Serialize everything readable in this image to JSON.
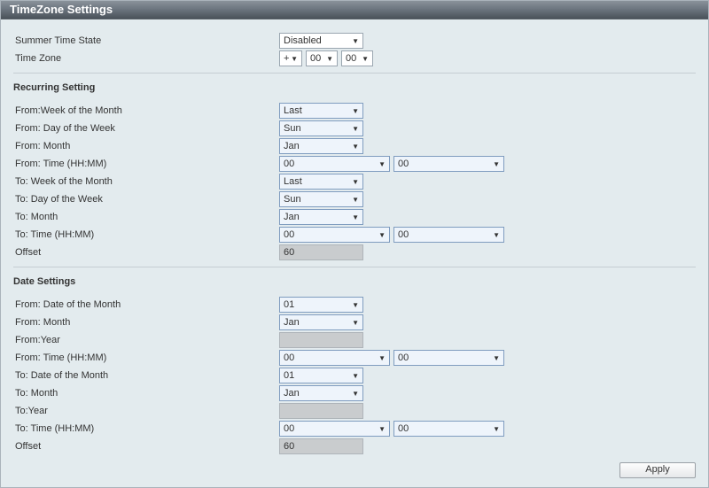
{
  "title": "TimeZone Settings",
  "general": {
    "summerLabel": "Summer Time State",
    "summerValue": "Disabled",
    "tzLabel": "Time Zone",
    "tzSign": "+",
    "tzHH": "00",
    "tzMM": "00"
  },
  "recurring": {
    "head": "Recurring Setting",
    "fromWeekLbl": "From:Week of the Month",
    "fromWeekVal": "Last",
    "fromDayLbl": "From: Day of the Week",
    "fromDayVal": "Sun",
    "fromMonthLbl": "From: Month",
    "fromMonthVal": "Jan",
    "fromTimeLbl": "From: Time (HH:MM)",
    "fromTimeHH": "00",
    "fromTimeMM": "00",
    "toWeekLbl": "To: Week of the Month",
    "toWeekVal": "Last",
    "toDayLbl": "To: Day of the Week",
    "toDayVal": "Sun",
    "toMonthLbl": "To: Month",
    "toMonthVal": "Jan",
    "toTimeLbl": "To: Time (HH:MM)",
    "toTimeHH": "00",
    "toTimeMM": "00",
    "offsetLbl": "Offset",
    "offsetVal": "60"
  },
  "date": {
    "head": "Date Settings",
    "fromDateLbl": "From: Date of the Month",
    "fromDateVal": "01",
    "fromMonthLbl": "From: Month",
    "fromMonthVal": "Jan",
    "fromYearLbl": "From:Year",
    "fromYearVal": "",
    "fromTimeLbl": "From: Time (HH:MM)",
    "fromTimeHH": "00",
    "fromTimeMM": "00",
    "toDateLbl": "To: Date of the Month",
    "toDateVal": "01",
    "toMonthLbl": "To: Month",
    "toMonthVal": "Jan",
    "toYearLbl": "To:Year",
    "toYearVal": "",
    "toTimeLbl": "To: Time (HH:MM)",
    "toTimeHH": "00",
    "toTimeMM": "00",
    "offsetLbl": "Offset",
    "offsetVal": "60"
  },
  "applyLabel": "Apply"
}
